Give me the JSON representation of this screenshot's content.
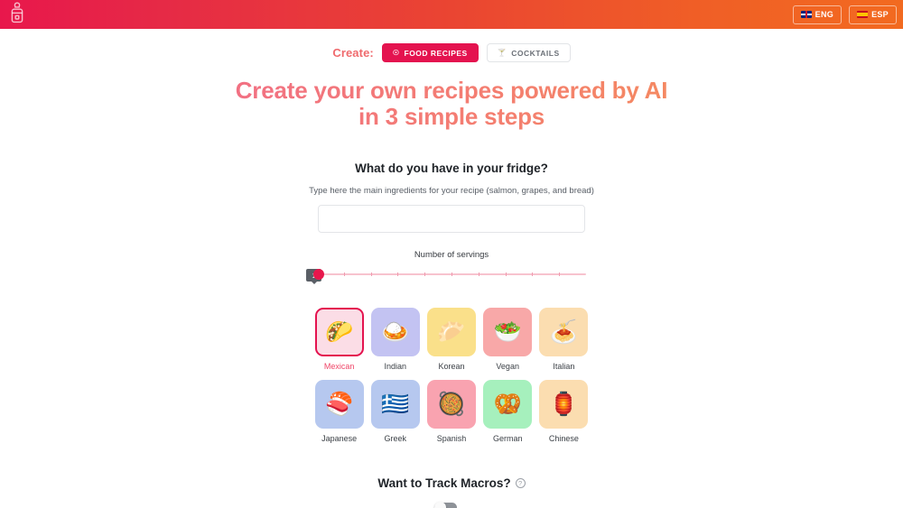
{
  "header": {
    "logo_name": "cocktail-shaker-logo",
    "languages": [
      {
        "label": "ENG",
        "flag": "uk-flag-icon",
        "name": "lang-eng"
      },
      {
        "label": "ESP",
        "flag": "spain-flag-icon",
        "name": "lang-esp"
      }
    ],
    "gradient_start": "#e8174c",
    "gradient_end": "#f26a20"
  },
  "create": {
    "label": "Create:",
    "label_color": "#ef6a6d",
    "tabs": [
      {
        "label": "FOOD RECIPES",
        "icon": "cooking-pot-icon",
        "active": true
      },
      {
        "label": "COCKTAILS",
        "icon": "cocktail-glass-icon",
        "active": false
      }
    ]
  },
  "hero": {
    "line1": "Create your own recipes powered by AI",
    "line2": "in 3 simple steps",
    "gradient_start": "#ef5f93",
    "gradient_end": "#f79a4c"
  },
  "fridge": {
    "title": "What do you have in your fridge?",
    "subtitle": "Type here the main ingredients for your recipe (salmon, grapes, and bread)",
    "input_value": "",
    "input_placeholder": ""
  },
  "servings": {
    "label": "Number of servings",
    "value": "1",
    "min": 1,
    "max": 10,
    "tick_count": 9,
    "thumb_color": "#e8174c",
    "track_color": "#f7c3ce"
  },
  "cuisines": [
    {
      "name": "Mexican",
      "icon": "taco-icon",
      "emoji": "🌮",
      "color": "#fbdde6",
      "selected": true
    },
    {
      "name": "Indian",
      "icon": "curry-rice-icon",
      "emoji": "🍛",
      "color": "#c3c3f2",
      "selected": false
    },
    {
      "name": "Korean",
      "icon": "dumpling-icon",
      "emoji": "🥟",
      "color": "#fae08a",
      "selected": false
    },
    {
      "name": "Vegan",
      "icon": "green-salad-icon",
      "emoji": "🥗",
      "color": "#f8a8a8",
      "selected": false
    },
    {
      "name": "Italian",
      "icon": "spaghetti-icon",
      "emoji": "🍝",
      "color": "#fbddb0",
      "selected": false
    },
    {
      "name": "Japanese",
      "icon": "sushi-icon",
      "emoji": "🍣",
      "color": "#b6c8ef",
      "selected": false
    },
    {
      "name": "Greek",
      "icon": "greece-flag-icon",
      "emoji": "🇬🇷",
      "color": "#b6c8ef",
      "selected": false
    },
    {
      "name": "Spanish",
      "icon": "paella-icon",
      "emoji": "🥘",
      "color": "#f9a3b0",
      "selected": false
    },
    {
      "name": "German",
      "icon": "pretzel-icon",
      "emoji": "🥨",
      "color": "#a6f0bd",
      "selected": false
    },
    {
      "name": "Chinese",
      "icon": "red-lantern-icon",
      "emoji": "🏮",
      "color": "#fbddb0",
      "selected": false
    }
  ],
  "macros": {
    "title": "Want to Track Macros?",
    "help_icon": "question-mark-circle-icon",
    "help_glyph": "?",
    "toggle_on": false
  }
}
